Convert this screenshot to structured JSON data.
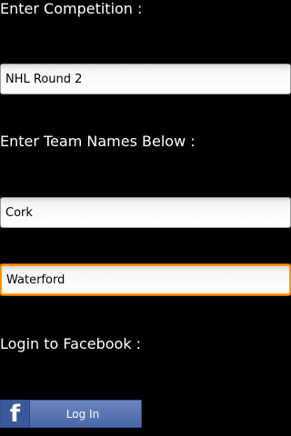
{
  "form": {
    "competition_label": "Enter Competition :",
    "competition_value": "NHL Round 2",
    "teams_label": "Enter Team Names Below :",
    "team1_value": "Cork",
    "team2_value": "Waterford",
    "facebook_label": "Login to Facebook :"
  },
  "facebook_button": {
    "logo": "f",
    "label": "Log In",
    "icon": "facebook-icon"
  },
  "colors": {
    "background": "#000000",
    "focus": "#ff9600",
    "facebook_blue": "#3b5998"
  }
}
